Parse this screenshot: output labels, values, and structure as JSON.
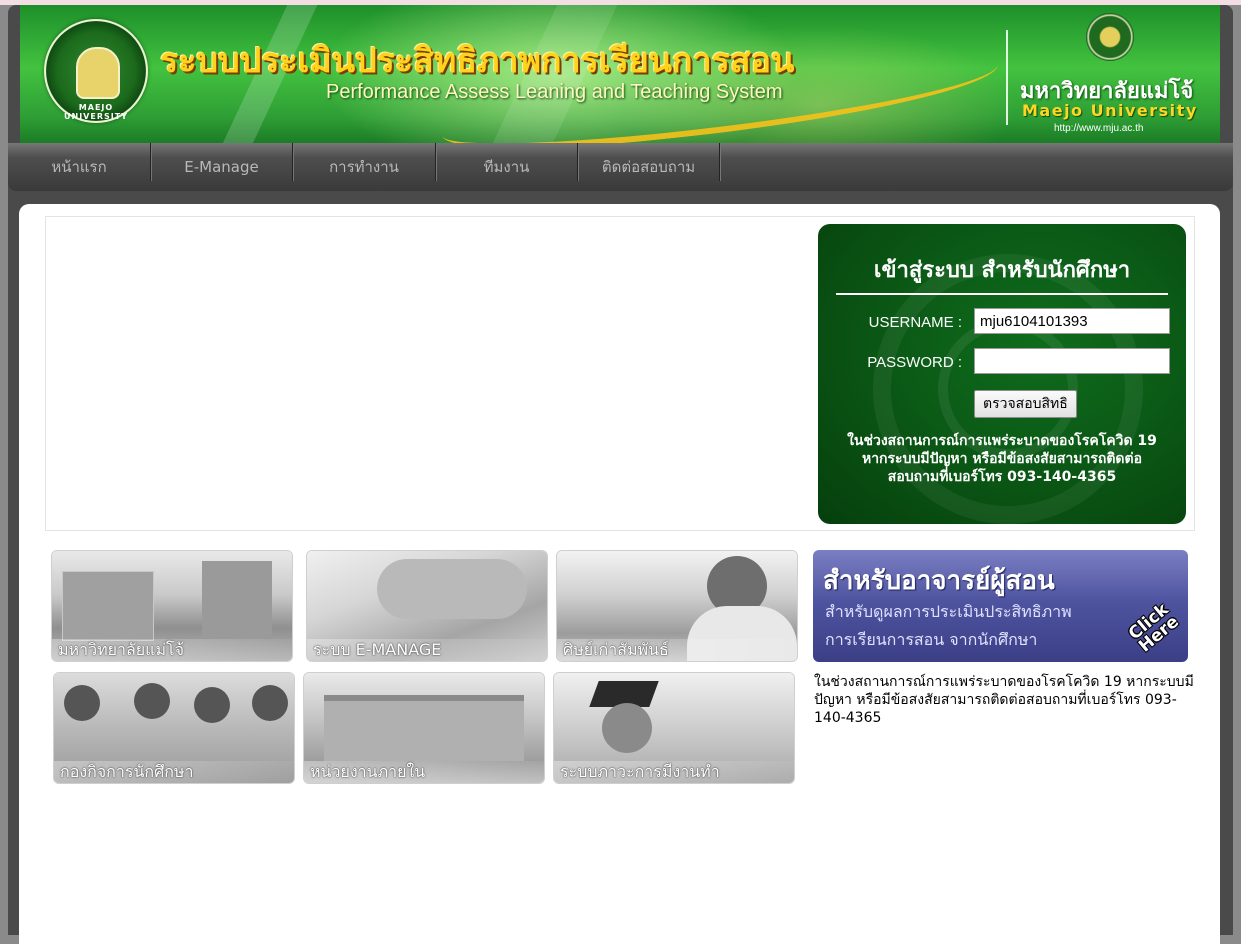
{
  "header": {
    "title_th": "ระบบประเมินประสิทธิภาพการเรียนการสอน",
    "title_en": "Performance Assess Leaning and Teaching System",
    "seal_text": "MAEJO UNIVERSITY",
    "university_th": "มหาวิทยาลัยแม่โจ้",
    "university_en": "Maejo University",
    "university_url": "http://www.mju.ac.th"
  },
  "nav": {
    "items": [
      {
        "label": "หน้าแรก"
      },
      {
        "label": "E-Manage"
      },
      {
        "label": "การทำงาน"
      },
      {
        "label": "ทีมงาน"
      },
      {
        "label": "ติดต่อสอบถาม"
      }
    ]
  },
  "login": {
    "title": "เข้าสู่ระบบ สำหรับนักศึกษา",
    "username_label": "USERNAME :",
    "username_value": "mju6104101393",
    "password_label": "PASSWORD :",
    "password_value": "",
    "submit_label": "ตรวจสอบสิทธิ",
    "note_line1": "ในช่วงสถานการณ์การแพร่ระบาดของโรคโควิด 19",
    "note_line2": "หากระบบมีปัญหา หรือมีข้อสงสัยสามารถติดต่อ",
    "note_line3": "สอบถามที่เบอร์โทร 093-140-4365"
  },
  "tiles": [
    {
      "caption": "มหาวิทยาลัยแม่โจ้"
    },
    {
      "caption": "ระบบ E-MANAGE"
    },
    {
      "caption": "ศิษย์เก่าสัมพันธ์"
    },
    {
      "caption": "กองกิจการนักศึกษา"
    },
    {
      "caption": "หน่วยงานภายใน"
    },
    {
      "caption": "ระบบภาวะการมีงานทำ"
    }
  ],
  "teacher_banner": {
    "title": "สำหรับอาจารย์ผู้สอน",
    "line1": "สำหรับดูผลการประเมินประสิทธิภาพ",
    "line2": "การเรียนการสอน จากนักศึกษา",
    "click": "Click",
    "here": "Here"
  },
  "side_note": "ในช่วงสถานการณ์การแพร่ระบาดของโรคโควิด 19 หากระบบมีปัญหา หรือมีข้อสงสัยสามารถติดต่อสอบถามที่เบอร์โทร 093-140-4365",
  "colors": {
    "header_green": "#2e9e35",
    "login_green": "#0b5a16",
    "title_gold": "#ffd21c",
    "teacher_purple": "#4f54a0"
  }
}
